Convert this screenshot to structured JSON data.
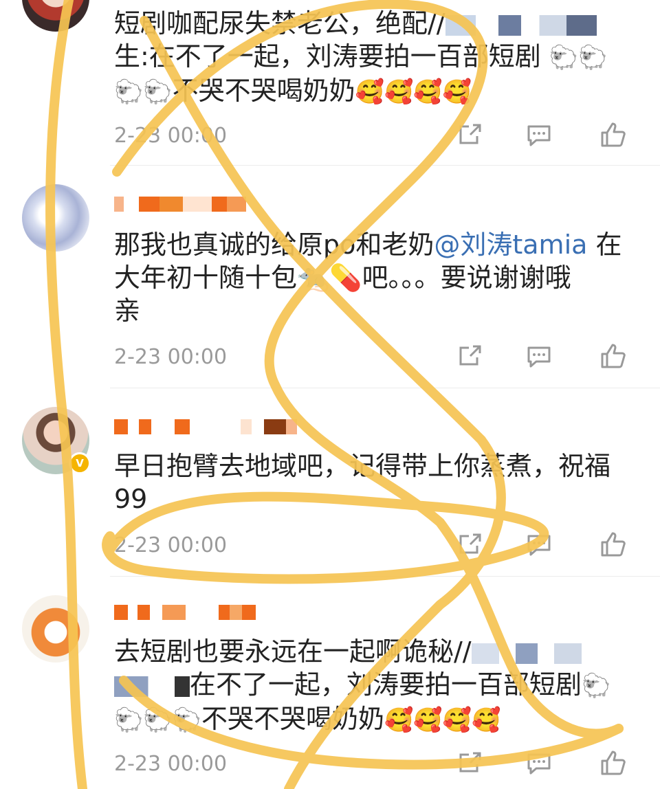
{
  "comments": [
    {
      "text_line1": "短剧咖配尿失禁老公，绝配//",
      "text_line2": "生:在不了一起，刘涛要拍一百部短剧",
      "text_line3": "不哭不哭喝奶奶",
      "emoji": "🥰",
      "time": "2-23 00:00"
    },
    {
      "text_line1a": "那我也真诚的给原po和老奶",
      "mention": "@刘涛tamia",
      "text_line1b": " 在",
      "text_line2": "大年初十随十包🐀💊吧。。。要说谢谢哦",
      "text_line3": "亲",
      "time": "2-23 00:00"
    },
    {
      "text_line1": "早日抱臂去地域吧，记得带上你蒸煮，祝福",
      "text_line2": "99",
      "time": "2-23 00:00"
    },
    {
      "text_line1": "去短剧也要永远在一起啊诡秘//",
      "text_line2": "在不了一起，刘涛要拍一百部短剧",
      "text_line3": "不哭不哭喝奶奶",
      "emoji": "🥰",
      "time": "2-23 00:00"
    }
  ],
  "icons": {
    "share": "share-icon",
    "comment": "comment-icon",
    "like": "thumbs-up-icon"
  },
  "colors": {
    "mention": "#3a6fb3",
    "scribble": "#f6c453",
    "redaction": "#f06a1c"
  }
}
